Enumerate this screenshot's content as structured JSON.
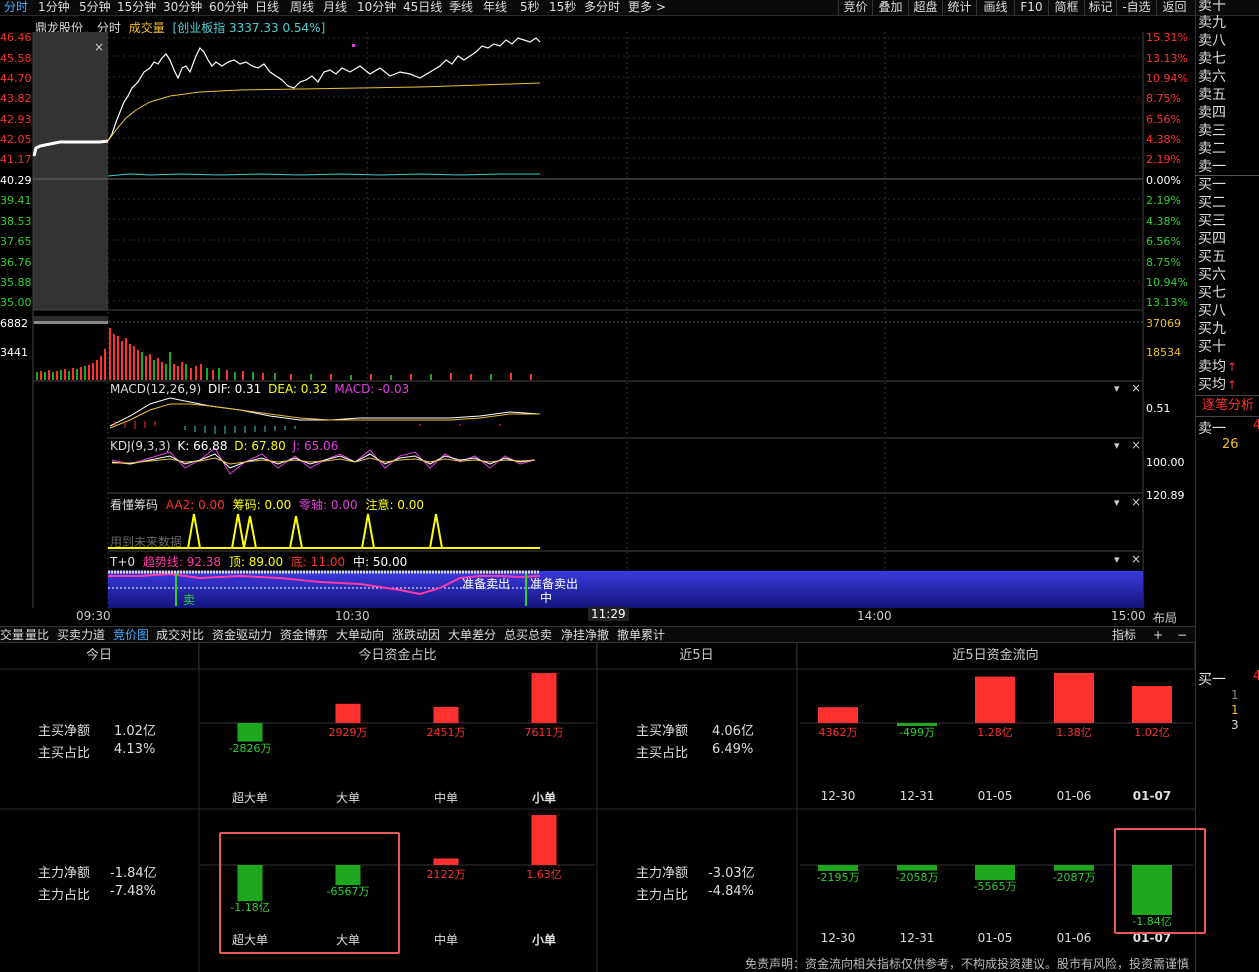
{
  "toolbar": {
    "periods": [
      "分时",
      "1分钟",
      "5分钟",
      "15分钟",
      "30分钟",
      "60分钟",
      "日线",
      "周线",
      "月线",
      "10分钟",
      "45日线",
      "季线",
      "年线",
      "5秒",
      "15秒",
      "多分时",
      "更多 >"
    ],
    "right": [
      "竞价",
      "叠加",
      "超盘",
      "统计",
      "画线",
      "F10",
      "简框",
      "标记",
      "-自选",
      "返回"
    ]
  },
  "chart_header": {
    "stock": "鼎龙股份",
    "mode": "分时",
    "volume": "成交量",
    "index": "[创业板指 3337.33 0.54%]"
  },
  "price_axis_left": [
    "46.46",
    "45.58",
    "44.70",
    "43.82",
    "42.93",
    "42.05",
    "41.17",
    "40.29",
    "39.41",
    "38.53",
    "37.65",
    "36.76",
    "35.88",
    "35.00"
  ],
  "pct_axis_right": [
    "15.31%",
    "13.13%",
    "10.94%",
    "8.75%",
    "6.56%",
    "4.38%",
    "2.19%",
    "0.00%",
    "2.19%",
    "4.38%",
    "6.56%",
    "8.75%",
    "10.94%",
    "13.13%"
  ],
  "volume_axis": {
    "left_top": "6882",
    "left_mid": "3441",
    "right_top": "37069",
    "right_mid": "18534"
  },
  "indicators": {
    "macd": {
      "name": "MACD(12,26,9)",
      "dif": "DIF: 0.31",
      "dea": "DEA: 0.32",
      "macd": "MACD: -0.03",
      "axis": "0.51"
    },
    "kdj": {
      "name": "KDJ(9,3,3)",
      "k": "K: 66.88",
      "d": "D: 67.80",
      "j": "J: 65.06",
      "axis": "100.00"
    },
    "kandong": {
      "name": "看懂筹码",
      "aa2": "AA2: 0.00",
      "chouma": "筹码: 0.00",
      "lingzhou": "零轴: 0.00",
      "zhuyi": "注意: 0.00",
      "note": "用到未来数据",
      "axis": "120.89"
    },
    "t0": {
      "name": "T+0",
      "trend": "趋势线: 92.38",
      "top": "顶: 89.00",
      "bottom": "底: 11.00",
      "mid": "中: 50.00",
      "sig1": "准备卖出",
      "sig2": "准备卖出",
      "sell": "卖",
      "zhong": "中"
    }
  },
  "time_axis": [
    "09:30",
    "10:30",
    "11:29",
    "14:00",
    "15:00"
  ],
  "layout_btn": "布局",
  "order_book": {
    "sells": [
      "卖十",
      "卖九",
      "卖八",
      "卖七",
      "卖六",
      "卖五",
      "卖四",
      "卖三",
      "卖二",
      "卖一"
    ],
    "buys": [
      "买一",
      "买二",
      "买三",
      "买四",
      "买五",
      "买六",
      "买七",
      "买八",
      "买九",
      "买十"
    ],
    "avg_sell": "卖均",
    "avg_buy": "买均",
    "tick": "逐笔分析",
    "sell1": "卖一",
    "val_26": "26",
    "val_4": "4",
    "buy1": "买一",
    "nums": [
      "1",
      "1",
      "3"
    ],
    "val_4b": "4"
  },
  "bottom_tabs": [
    "交量",
    "量比",
    "买卖力道",
    "竞价图",
    "成交对比",
    "资金驱动力",
    "资金博弈",
    "大单动向",
    "涨跌动因",
    "大单差分",
    "总买总卖",
    "净挂净撤",
    "撤单累计"
  ],
  "bottom_right": {
    "indicator": "指标",
    "plus": "+",
    "minus": "−"
  },
  "sections": {
    "today": "今日",
    "today_ratio": "今日资金占比",
    "recent5": "近5日",
    "recent5_flow": "近5日资金流向"
  },
  "today_stats": {
    "main_buy_net_label": "主买净额",
    "main_buy_net": "1.02亿",
    "main_buy_ratio_label": "主买占比",
    "main_buy_ratio": "4.13%",
    "main_net_label": "主力净额",
    "main_net": "-1.84亿",
    "main_ratio_label": "主力占比",
    "main_ratio": "-7.48%"
  },
  "five_stats": {
    "main_buy_net_label": "主买净额",
    "main_buy_net": "4.06亿",
    "main_buy_ratio_label": "主买占比",
    "main_buy_ratio": "6.49%",
    "main_net_label": "主力净额",
    "main_net": "-3.03亿",
    "main_ratio_label": "主力占比",
    "main_ratio": "-4.84%"
  },
  "categories": [
    "超大单",
    "大单",
    "中单",
    "小单"
  ],
  "today_top_bars": [
    {
      "label": "-2826万",
      "value": -2826
    },
    {
      "label": "2929万",
      "value": 2929
    },
    {
      "label": "2451万",
      "value": 2451
    },
    {
      "label": "7611万",
      "value": 7611
    }
  ],
  "today_bottom_bars": [
    {
      "label": "-1.18亿",
      "value": -11800
    },
    {
      "label": "-6567万",
      "value": -6567
    },
    {
      "label": "2122万",
      "value": 2122
    },
    {
      "label": "1.63亿",
      "value": 16300
    }
  ],
  "dates": [
    "12-30",
    "12-31",
    "01-05",
    "01-06",
    "01-07"
  ],
  "five_top_bars": [
    {
      "label": "4362万",
      "value": 4362
    },
    {
      "label": "-499万",
      "value": -499
    },
    {
      "label": "1.28亿",
      "value": 12800
    },
    {
      "label": "1.38亿",
      "value": 13800
    },
    {
      "label": "1.02亿",
      "value": 10200
    }
  ],
  "five_bottom_bars": [
    {
      "label": "-2195万",
      "value": -2195
    },
    {
      "label": "-2058万",
      "value": -2058
    },
    {
      "label": "-5565万",
      "value": -5565
    },
    {
      "label": "-2087万",
      "value": -2087
    },
    {
      "label": "-1.84亿",
      "value": -18400
    }
  ],
  "disclaimer": "免责声明：资金流向相关指标仅供参考，不构成投资建议。股市有风险，投资需谨慎",
  "colors": {
    "up": "#ff3030",
    "down": "#1fa81f",
    "price_line": "#ffffff",
    "avg_line": "#e6c23a"
  }
}
